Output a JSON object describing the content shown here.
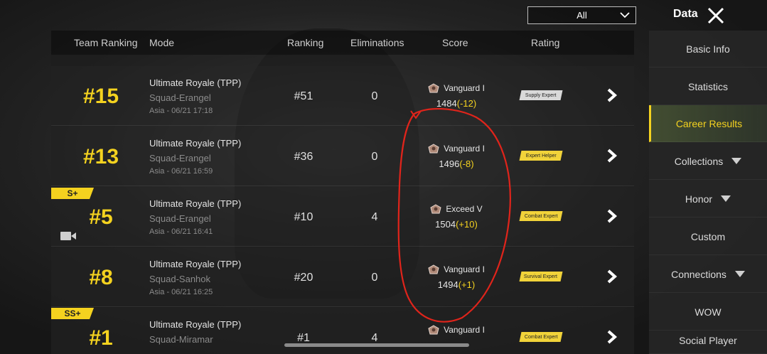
{
  "header": {
    "filter_value": "All",
    "title": "Data"
  },
  "table": {
    "columns": [
      "Team Ranking",
      "Mode",
      "Ranking",
      "Eliminations",
      "Score",
      "Rating"
    ],
    "rows": [
      {
        "team_rank": "#15",
        "grade": "",
        "mode": "Ultimate Royale (TPP)",
        "map": "Squad-Erangel",
        "time": "Asia - 06/21 17:18",
        "ranking": "#51",
        "eliminations": "0",
        "tier": "Vanguard I",
        "score": "1484",
        "delta": "(-12)",
        "rating": "Supply Expert",
        "rating_style": "light"
      },
      {
        "team_rank": "#13",
        "grade": "",
        "mode": "Ultimate Royale (TPP)",
        "map": "Squad-Erangel",
        "time": "Asia - 06/21 16:59",
        "ranking": "#36",
        "eliminations": "0",
        "tier": "Vanguard I",
        "score": "1496",
        "delta": "(-8)",
        "rating": "Expert Helper",
        "rating_style": "gold"
      },
      {
        "team_rank": "#5",
        "grade": "S+",
        "mode": "Ultimate Royale (TPP)",
        "map": "Squad-Erangel",
        "time": "Asia - 06/21 16:41",
        "ranking": "#10",
        "eliminations": "4",
        "tier": "Exceed V",
        "score": "1504",
        "delta": "(+10)",
        "rating": "Combat Expert",
        "rating_style": "gold"
      },
      {
        "team_rank": "#8",
        "grade": "",
        "mode": "Ultimate Royale (TPP)",
        "map": "Squad-Sanhok",
        "time": "Asia - 06/21 16:25",
        "ranking": "#20",
        "eliminations": "0",
        "tier": "Vanguard I",
        "score": "1494",
        "delta": "(+1)",
        "rating": "Survival Expert",
        "rating_style": "gold"
      },
      {
        "team_rank": "#1",
        "grade": "SS+",
        "mode": "Ultimate Royale (TPP)",
        "map": "Squad-Miramar",
        "time": "",
        "ranking": "#1",
        "eliminations": "4",
        "tier": "Vanguard I",
        "score": "",
        "delta": "",
        "rating": "Combat Expert",
        "rating_style": "gold"
      }
    ]
  },
  "sidebar": {
    "items": [
      {
        "label": "Basic Info",
        "dropdown": false,
        "active": false
      },
      {
        "label": "Statistics",
        "dropdown": false,
        "active": false
      },
      {
        "label": "Career Results",
        "dropdown": false,
        "active": true
      },
      {
        "label": "Collections",
        "dropdown": true,
        "active": false
      },
      {
        "label": "Honor",
        "dropdown": true,
        "active": false
      },
      {
        "label": "Custom",
        "dropdown": false,
        "active": false
      },
      {
        "label": "Connections",
        "dropdown": true,
        "active": false
      },
      {
        "label": "WOW",
        "dropdown": false,
        "active": false
      },
      {
        "label": "Social Player",
        "dropdown": false,
        "active": false
      }
    ]
  },
  "colors": {
    "accent_yellow": "#f4d21f",
    "annotation_red": "#e0241b"
  },
  "icons": [
    "chevron-down-icon",
    "close-icon",
    "chevron-right-icon",
    "rank-badge-icon",
    "video-camera-icon",
    "triangle-down-icon"
  ]
}
